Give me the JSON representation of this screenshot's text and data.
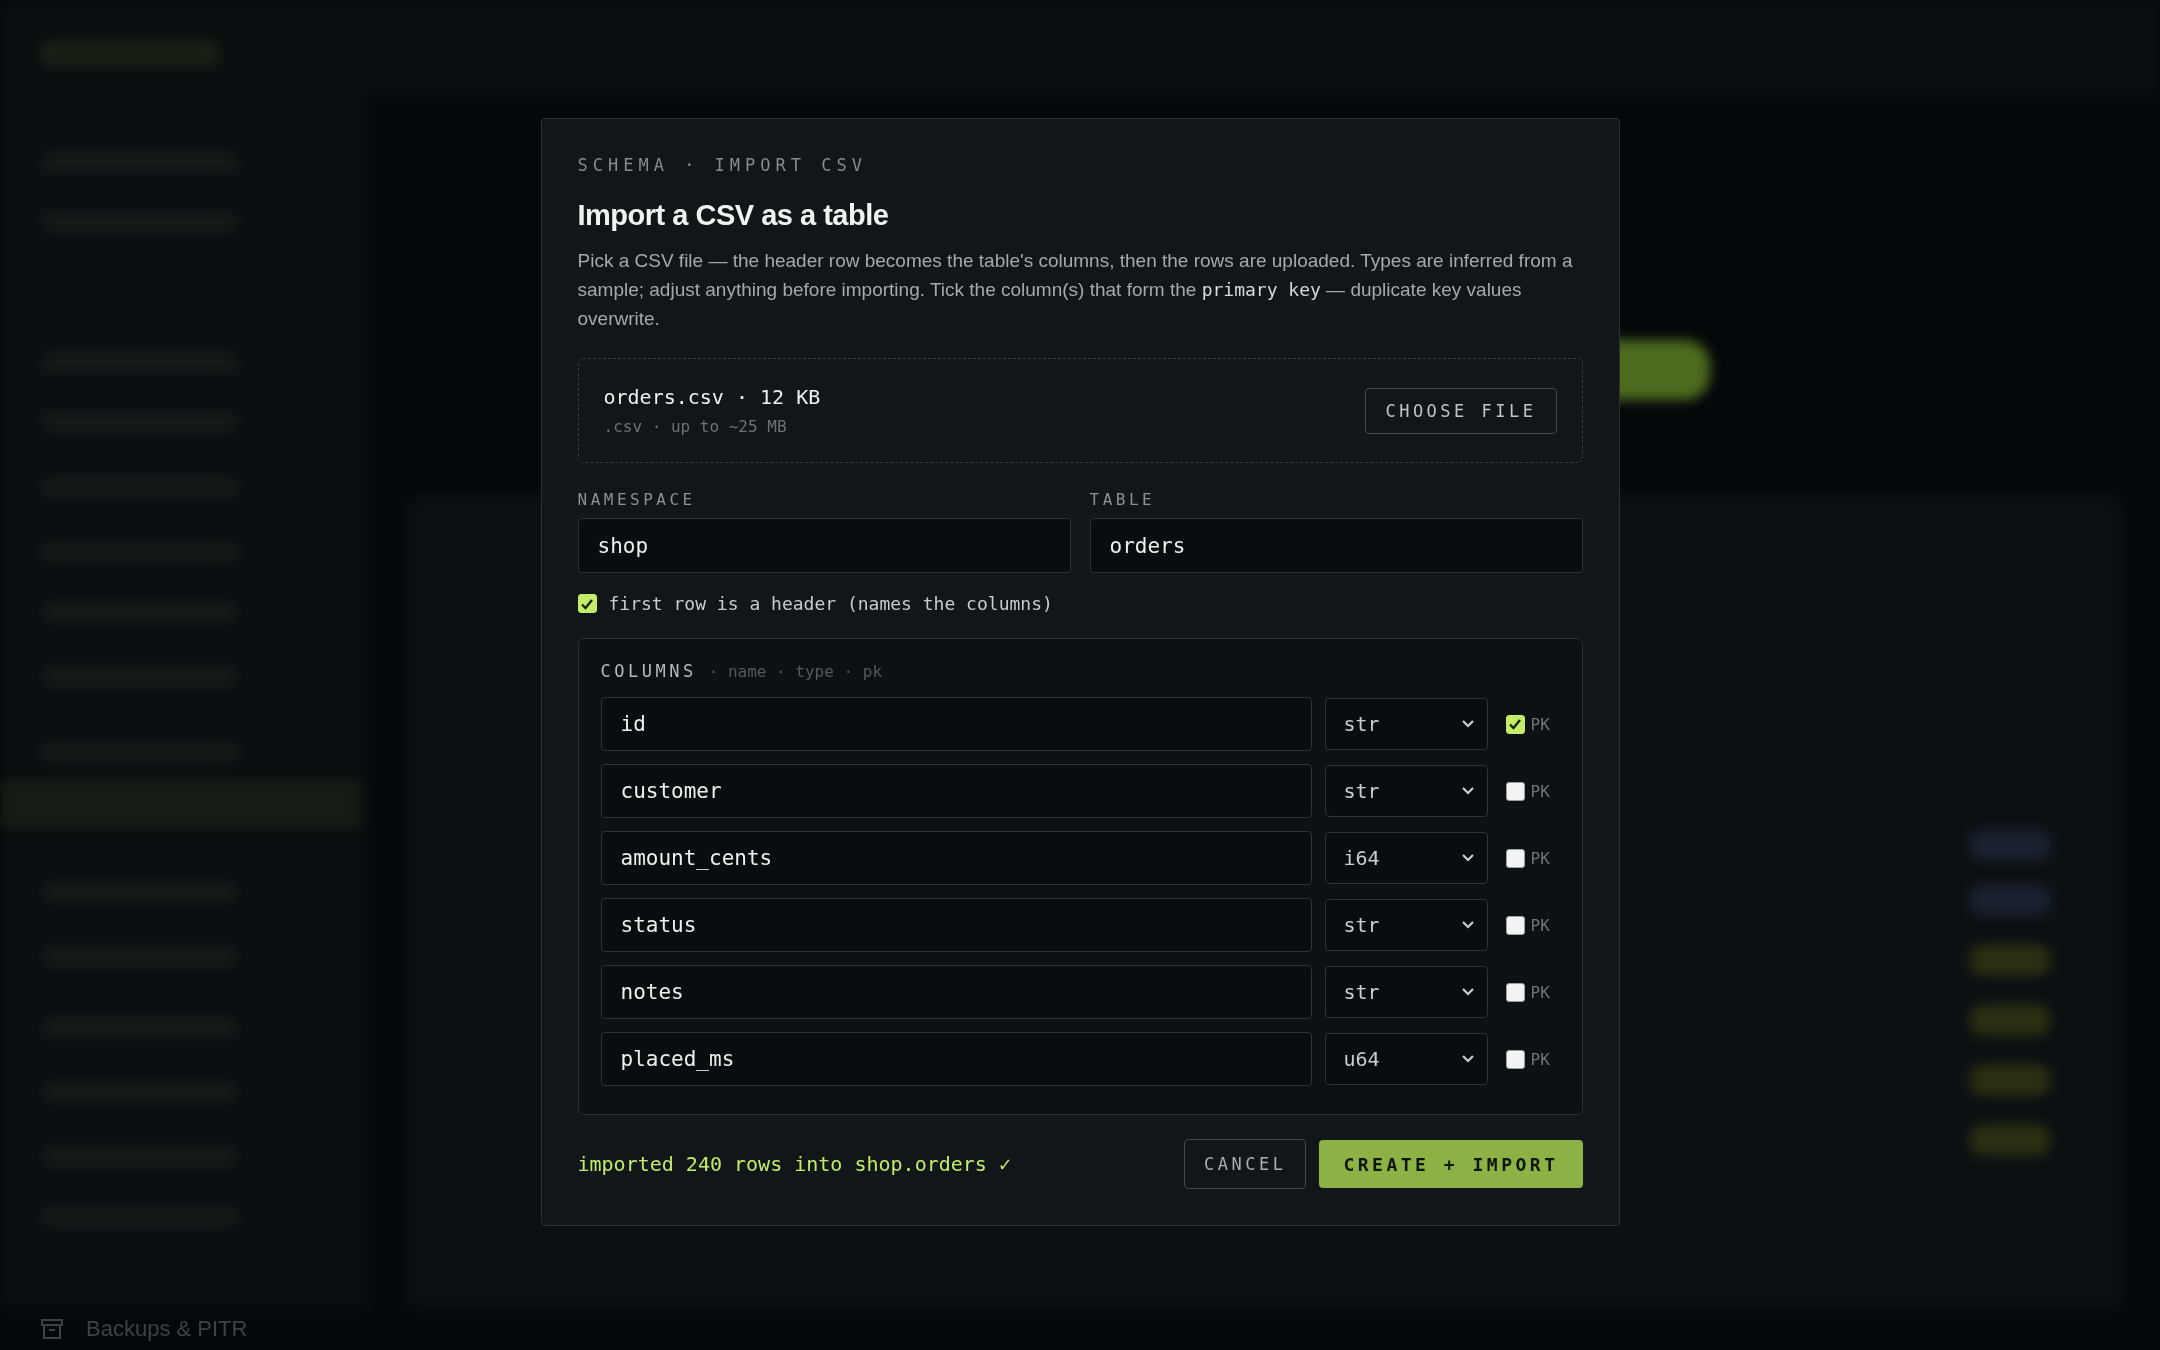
{
  "background": {
    "sidebar_item": "Backups & PITR"
  },
  "dialog": {
    "eyebrow": "SCHEMA · IMPORT CSV",
    "title": "Import a CSV as a table",
    "description": [
      {
        "kind": "plain",
        "text": "Pick a CSV file — the header row becomes the table's columns, then the rows are uploaded. Types are inferred from a sample; adjust anything before importing. Tick the column(s) that form the "
      },
      {
        "kind": "code",
        "text": "primary key"
      },
      {
        "kind": "plain",
        "text": " — duplicate key values overwrite."
      }
    ],
    "file": {
      "name": "orders.csv · 12 KB",
      "hint": ".csv · up to ~25 MB",
      "button": "CHOOSE FILE"
    },
    "namespace": {
      "label": "NAMESPACE",
      "value": "shop"
    },
    "table": {
      "label": "TABLE",
      "value": "orders"
    },
    "header_row": {
      "label": "first row is a header (names the columns)",
      "checked": true
    },
    "columns": {
      "title": "COLUMNS",
      "subtitle": "· name · type · pk",
      "rows": [
        {
          "name": "id",
          "type": "str",
          "pk_label": "PK",
          "checked": true
        },
        {
          "name": "customer",
          "type": "str",
          "pk_label": "PK",
          "checked": false
        },
        {
          "name": "amount_cents",
          "type": "i64",
          "pk_label": "PK",
          "checked": false
        },
        {
          "name": "status",
          "type": "str",
          "pk_label": "PK",
          "checked": false
        },
        {
          "name": "notes",
          "type": "str",
          "pk_label": "PK",
          "checked": false
        },
        {
          "name": "placed_ms",
          "type": "u64",
          "pk_label": "PK",
          "checked": false
        }
      ]
    },
    "status": "imported 240 rows into shop.orders ✓",
    "buttons": {
      "cancel": "CANCEL",
      "submit": "CREATE + IMPORT"
    }
  }
}
